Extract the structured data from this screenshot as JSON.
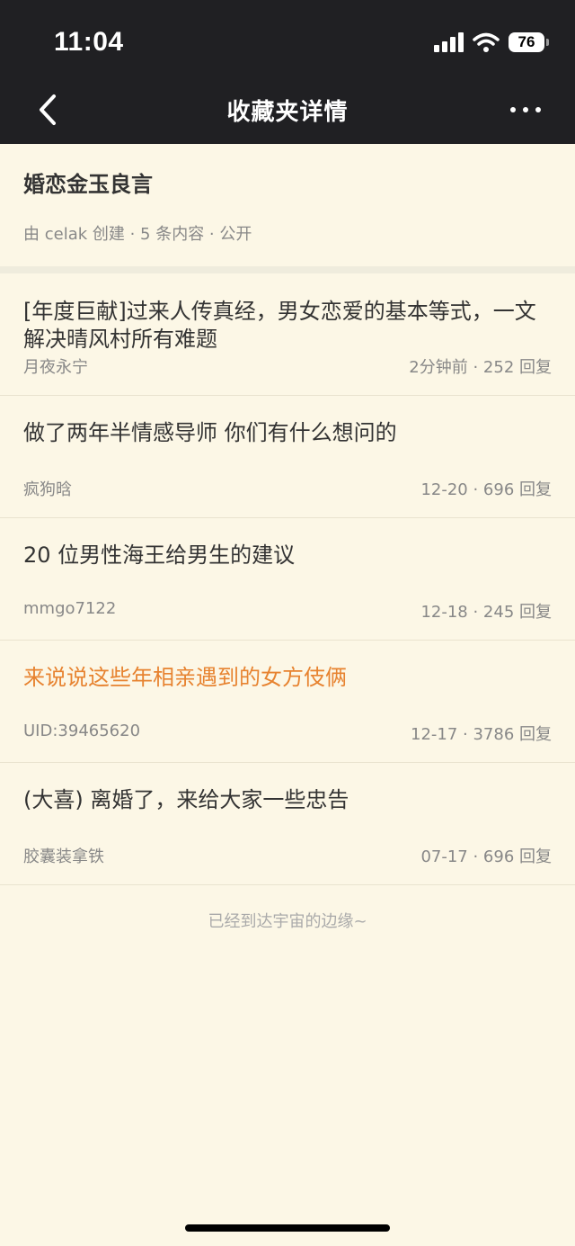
{
  "status_bar": {
    "time": "11:04",
    "battery": "76"
  },
  "nav": {
    "title": "收藏夹详情"
  },
  "folder": {
    "name": "婚恋金玉良言",
    "meta": "由 celak 创建 · 5 条内容 · 公开"
  },
  "posts": [
    {
      "title": "[年度巨献]过来人传真经，男女恋爱的基本等式，一文解决晴风村所有难题",
      "author": "月夜永宁",
      "stats": "2分钟前 · 252 回复"
    },
    {
      "title": "做了两年半情感导师 你们有什么想问的",
      "author": "疯狗晗",
      "stats": "12-20 · 696 回复"
    },
    {
      "title": "20 位男性海王给男生的建议",
      "author": "mmgo7122",
      "stats": "12-18 · 245 回复"
    },
    {
      "title": "来说说这些年相亲遇到的女方伎俩",
      "author": "UID:39465620",
      "stats": "12-17 · 3786 回复"
    },
    {
      "title": "(大喜) 离婚了，来给大家一些忠告",
      "author": "胶囊装拿铁",
      "stats": "07-17 · 696 回复"
    }
  ],
  "footer": {
    "end_text": "已经到达宇宙的边缘~"
  },
  "colors": {
    "top_bar": "#202023",
    "background": "#fcf7e6",
    "highlight_title": "#e78330"
  }
}
